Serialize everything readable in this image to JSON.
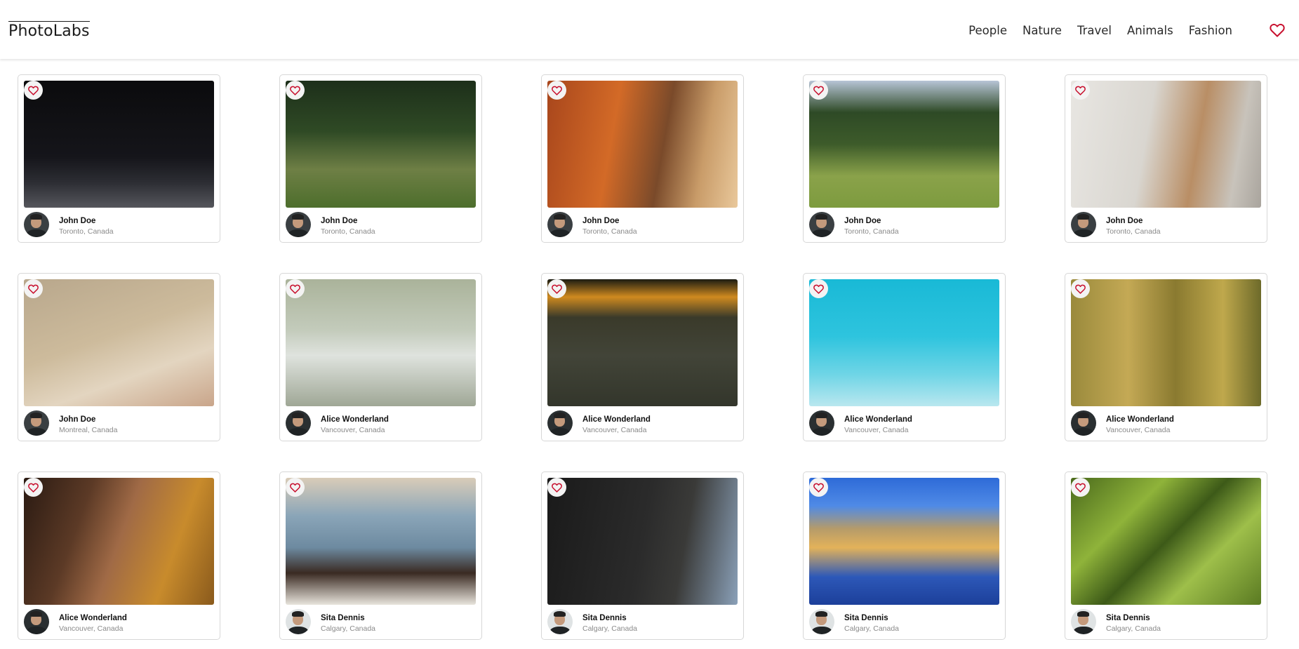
{
  "app": {
    "logo": "PhotoLabs"
  },
  "nav": {
    "topics": [
      "People",
      "Nature",
      "Travel",
      "Animals",
      "Fashion"
    ],
    "favorites_icon": "heart-outline-icon"
  },
  "colors": {
    "heart": "#c8102e",
    "border": "#d7d7d7",
    "muted": "#8a8a8a"
  },
  "photos": [
    {
      "user": "John Doe",
      "location": "Toronto, Canada",
      "subject": "man-walking-night",
      "bg": "linear-gradient(180deg,#0b0b0d 0%,#15151a 60%,#2c2d33 80%,#55565c 100%)"
    },
    {
      "user": "John Doe",
      "location": "Toronto, Canada",
      "subject": "jaguar-in-jungle",
      "bg": "linear-gradient(180deg,#1d2f1a 0%,#2f4a25 40%,#6e7f45 70%,#4d6e2c 100%)"
    },
    {
      "user": "John Doe",
      "location": "Toronto, Canada",
      "subject": "orange-buildings-temple",
      "bg": "linear-gradient(100deg,#a8461c 0%,#d36a27 35%,#7a4a2a 60%,#c99c69 80%,#e9c89b 100%)"
    },
    {
      "user": "John Doe",
      "location": "Toronto, Canada",
      "subject": "horses-on-hill",
      "bg": "linear-gradient(180deg,#b7c4d6 0%,#2e4a26 25%,#3d5b2a 50%,#8aa24a 75%,#7d9b3e 100%)"
    },
    {
      "user": "John Doe",
      "location": "Toronto, Canada",
      "subject": "man-with-mug",
      "bg": "linear-gradient(100deg,#e8e6e2 0%,#d9d6d0 40%,#b98e65 65%,#c8c3bb 85%,#a9a49d 100%)"
    },
    {
      "user": "John Doe",
      "location": "Montreal, Canada",
      "subject": "phone-in-hand",
      "bg": "linear-gradient(160deg,#b8a78c 0%,#cdbb9c 45%,#e3d5c0 70%,#c9a58a 100%)"
    },
    {
      "user": "Alice Wonderland",
      "location": "Vancouver, Canada",
      "subject": "woman-white-top",
      "bg": "linear-gradient(180deg,#aab39a 0%,#c3cbbb 40%,#dfe3de 60%,#9fa796 100%)"
    },
    {
      "user": "Alice Wonderland",
      "location": "Vancouver, Canada",
      "subject": "dog-lying-grass",
      "bg": "linear-gradient(180deg,#1c1c12 0%,#cf8a1f 14%,#3a3a2a 30%,#424438 60%,#33362b 100%)"
    },
    {
      "user": "Alice Wonderland",
      "location": "Vancouver, Canada",
      "subject": "palm-trees-sky",
      "bg": "linear-gradient(180deg,#19b9d6 0%,#2ec4de 45%,#6fd5e6 75%,#b9e7ef 100%)"
    },
    {
      "user": "Alice Wonderland",
      "location": "Vancouver, Canada",
      "subject": "bird-in-reeds",
      "bg": "linear-gradient(90deg,#9a8a3c 0%,#c4a955 30%,#8a7a30 55%,#bfa84c 80%,#6d6a2a 100%)"
    },
    {
      "user": "Alice Wonderland",
      "location": "Vancouver, Canada",
      "subject": "woman-curly-hair",
      "bg": "linear-gradient(110deg,#2a1a12 0%,#5c3a26 30%,#a06a46 50%,#c88b2c 75%,#8a5a1c 100%)"
    },
    {
      "user": "Sita Dennis",
      "location": "Calgary, Canada",
      "subject": "man-denim-shirt",
      "bg": "linear-gradient(180deg,#d9ccb8 0%,#8aa5b8 30%,#6d8aa0 55%,#3a2a22 75%,#e8e4dc 100%)"
    },
    {
      "user": "Sita Dennis",
      "location": "Calgary, Canada",
      "subject": "black-dog-closeup",
      "bg": "linear-gradient(100deg,#1a1a1a 0%,#2b2b2b 50%,#3a3a38 70%,#8aa0b8 100%)"
    },
    {
      "user": "Sita Dennis",
      "location": "Calgary, Canada",
      "subject": "colorful-harbor",
      "bg": "linear-gradient(180deg,#2e6bd8 0%,#4f8ae6 22%,#b59b6a 40%,#e3b25a 55%,#2d58b8 78%,#1c3f9a 100%)"
    },
    {
      "user": "Sita Dennis",
      "location": "Calgary, Canada",
      "subject": "rice-terraces",
      "bg": "linear-gradient(135deg,#4a6a1c 0%,#8fb33a 30%,#3d5a18 50%,#9ebf4a 70%,#5a7a22 100%)"
    }
  ]
}
